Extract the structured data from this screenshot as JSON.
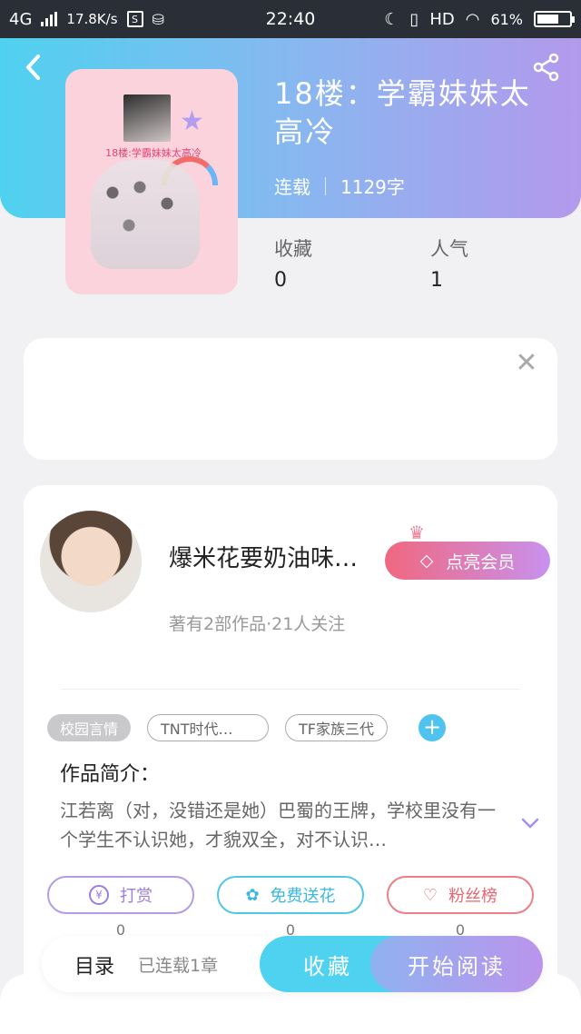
{
  "status_bar": {
    "network": "4G",
    "speed": "17.8K/s",
    "time": "22:40",
    "hd": "HD",
    "battery": "61%"
  },
  "book": {
    "title": "18楼：学霸妹妹太高冷",
    "cover_caption": "18楼:学霸妹妹太高冷",
    "status": "连载",
    "word_count": "1129字",
    "collect_label": "收藏",
    "collect_value": "0",
    "popularity_label": "人气",
    "popularity_value": "1"
  },
  "author": {
    "name": "爆米花要奶油味…",
    "meta": "著有2部作品·21人关注",
    "vip_button": "点亮会员"
  },
  "tags": [
    "校园言情",
    "TNT时代…",
    "TF家族三代"
  ],
  "intro": {
    "heading": "作品简介：",
    "body": "江若离（对，没错还是她）巴蜀的王牌，学校里没有一个学生不认识她，才貌双全，对不认识…"
  },
  "actions": {
    "reward": "打赏",
    "reward_count": "0",
    "flower": "免费送花",
    "flower_count": "0",
    "fans": "粉丝榜",
    "fans_count": "0"
  },
  "bottom": {
    "toc": "目录",
    "toc_sub": "已连载1章",
    "collect": "收藏",
    "read": "开始阅读"
  }
}
